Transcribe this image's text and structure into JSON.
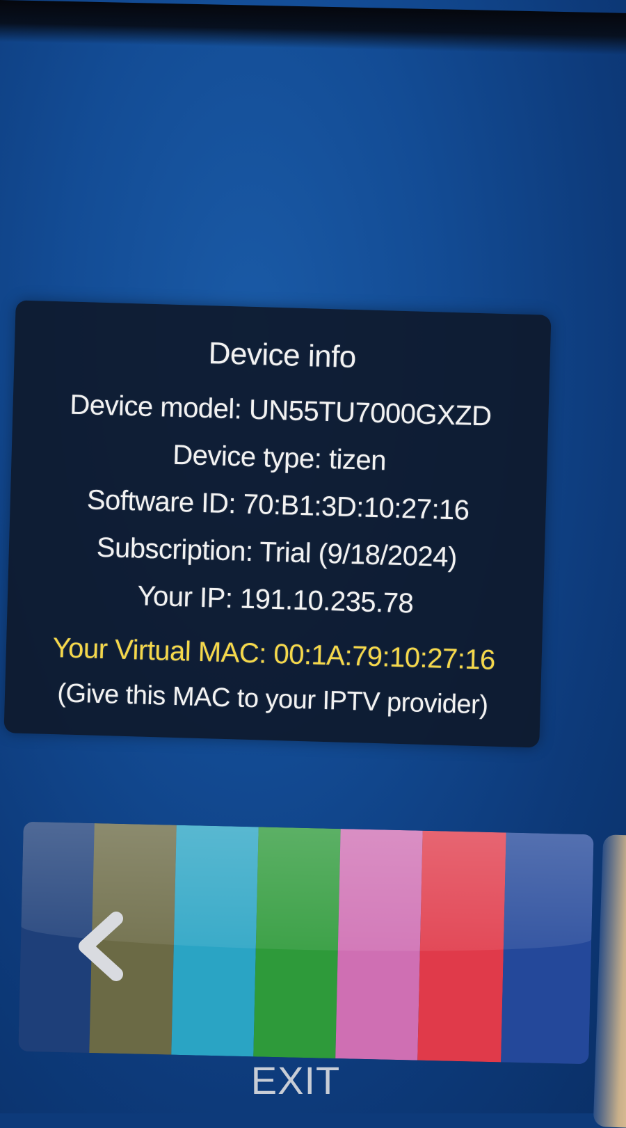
{
  "device_info": {
    "title": "Device info",
    "device_model": "Device model: UN55TU7000GXZD",
    "device_type": "Device type: tizen",
    "software_id": "Software ID: 70:B1:3D:10:27:16",
    "subscription": "Subscription: Trial (9/18/2024)",
    "your_ip": "Your IP: 191.10.235.78",
    "virtual_mac": "Your Virtual MAC: 00:1A:79:10:27:16",
    "mac_hint": "(Give this MAC to your IPTV provider)"
  },
  "carousel": {
    "back_icon": "chevron-left-icon",
    "bar_colors": [
      "#1e3f79",
      "#6b6a45",
      "#2aa4c4",
      "#2e9a3a",
      "#cf6fb3",
      "#e03a4a",
      "#24489a"
    ]
  },
  "exit": {
    "label": "EXIT"
  },
  "colors": {
    "background": "#134c95",
    "panel": "#0e182a",
    "mac_highlight": "#f5d84a",
    "text": "#f2f2f2"
  }
}
